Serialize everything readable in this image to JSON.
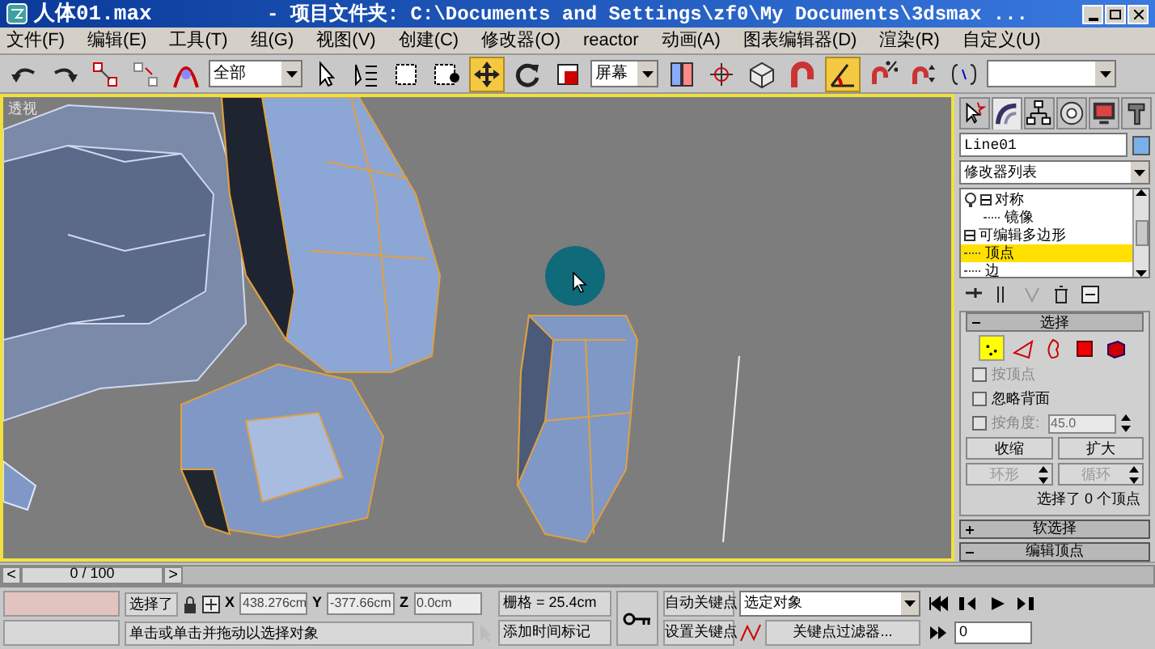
{
  "title_bar": {
    "file": "人体01.max",
    "path": "- 项目文件夹: C:\\Documents and Settings\\zf0\\My Documents\\3dsmax ..."
  },
  "menus": [
    "文件(F)",
    "编辑(E)",
    "工具(T)",
    "组(G)",
    "视图(V)",
    "创建(C)",
    "修改器(O)",
    "reactor",
    "动画(A)",
    "图表编辑器(D)",
    "渲染(R)",
    "自定义(U)"
  ],
  "toolbar": {
    "items": [
      {
        "kind": "undo",
        "selected": false
      },
      {
        "kind": "redo",
        "selected": false
      },
      {
        "kind": "link",
        "selected": false
      },
      {
        "kind": "unlink",
        "selected": false
      },
      {
        "kind": "bind",
        "selected": false
      },
      {
        "kind": "filter",
        "value": "全部"
      },
      {
        "kind": "pointer",
        "selected": false
      },
      {
        "kind": "list",
        "selected": false
      },
      {
        "kind": "rect",
        "selected": false
      },
      {
        "kind": "window",
        "selected": false
      },
      {
        "kind": "move",
        "selected": true
      },
      {
        "kind": "rotate",
        "selected": false
      },
      {
        "kind": "scale",
        "selected": false
      },
      {
        "kind": "coord",
        "value": "屏幕"
      },
      {
        "kind": "pivot",
        "selected": false
      },
      {
        "kind": "manip",
        "selected": false
      },
      {
        "kind": "keyboard",
        "selected": false
      },
      {
        "kind": "snap",
        "selected": false
      },
      {
        "kind": "angle",
        "selected": true
      },
      {
        "kind": "percent",
        "selected": false
      },
      {
        "kind": "spinner",
        "selected": false
      },
      {
        "kind": "edit",
        "selected": false
      },
      {
        "kind": "named",
        "value": ""
      }
    ]
  },
  "viewport": {
    "label": "透视"
  },
  "command_panel": {
    "tabs": [
      {
        "selected": false
      },
      {
        "selected": true
      },
      {
        "selected": false
      },
      {
        "selected": false
      },
      {
        "selected": false
      },
      {
        "selected": false
      }
    ],
    "object_name": "Line01",
    "modifier_list": "修改器列表",
    "stack": [
      {
        "label": "对称",
        "expanded": true,
        "children": [
          {
            "label": "镜像",
            "selected": false
          }
        ]
      },
      {
        "label": "可编辑多边形",
        "expanded": true,
        "children": [
          {
            "label": "顶点",
            "selected": true
          },
          {
            "label": "边",
            "selected": false
          }
        ]
      }
    ],
    "selection": {
      "title": "选择",
      "expanded": true,
      "subobjects": [
        {
          "selected": true
        },
        {
          "selected": false
        },
        {
          "selected": false
        },
        {
          "selected": false
        },
        {
          "selected": false
        }
      ],
      "options": [
        {
          "label": "按顶点",
          "checked": false,
          "disabled": true
        },
        {
          "label": "忽略背面",
          "checked": false,
          "disabled": false
        },
        {
          "label": "按角度:",
          "checked": false,
          "disabled": true,
          "value": "45.0"
        }
      ],
      "buttons": [
        {
          "label": "收缩",
          "disabled": false
        },
        {
          "label": "扩大",
          "disabled": false
        }
      ],
      "spinners": [
        {
          "label": "环形",
          "disabled": true
        },
        {
          "label": "循环",
          "disabled": true
        }
      ],
      "status": "选择了 0 个顶点"
    },
    "rollouts": [
      {
        "title": "软选择",
        "expanded": false
      },
      {
        "title": "编辑顶点",
        "expanded": true
      }
    ]
  },
  "timeline": {
    "prev": "<",
    "position": "0 / 100",
    "next": ">",
    "level": 0
  },
  "status_bar": {
    "selection": "选择了",
    "axes": [
      "X",
      "Y",
      "Z"
    ],
    "x": "438.276cm",
    "y": "-377.66cm",
    "z": "0.0cm",
    "grid": "栅格 = 25.4cm",
    "prompt": "单击或单击并拖动以选择对象",
    "time_tag": "添加时间标记",
    "auto_key": "自动关键点",
    "set_key": "设置关键点",
    "key_mode": "选定对象",
    "key_filters": "关键点过滤器...",
    "frame": "0"
  }
}
